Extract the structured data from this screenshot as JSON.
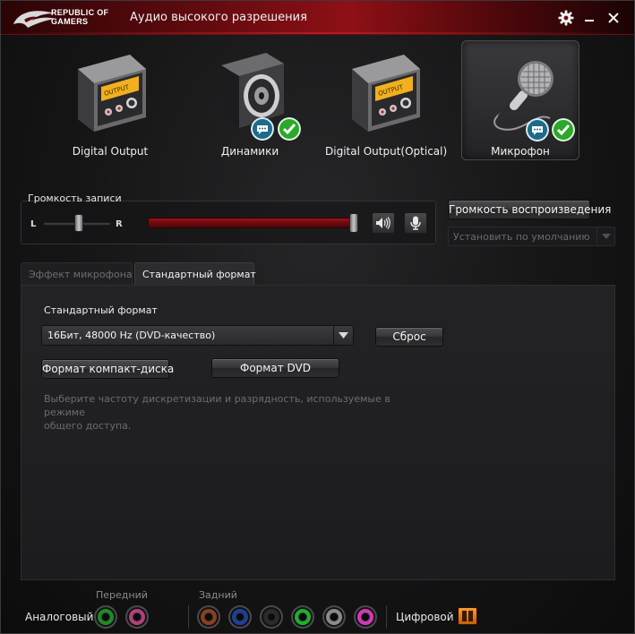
{
  "window": {
    "logo_text_line1": "REPUBLIC OF",
    "logo_text_line2": "GAMERS",
    "title": "Аудио высокого разрешения",
    "accent_color": "#8e1016"
  },
  "devices": [
    {
      "label": "Digital Output",
      "icon": "digital-output-device-icon",
      "active": false
    },
    {
      "label": "Динамики",
      "icon": "speaker-icon",
      "active": false,
      "badges": [
        "chat-bubble-icon",
        "check-icon"
      ]
    },
    {
      "label": "Digital Output(Optical)",
      "icon": "optical-output-device-icon",
      "active": false
    },
    {
      "label": "Микрофон",
      "icon": "microphone-icon",
      "active": true,
      "badges": [
        "chat-bubble-icon",
        "check-icon"
      ]
    }
  ],
  "record": {
    "label": "Громкость записи",
    "left": "L",
    "right": "R",
    "balance": 0.5,
    "volume": 1.0
  },
  "side": {
    "playback_volume_button": "Громкость воспроизведения",
    "set_default": "Установить по умолчанию"
  },
  "tabs": [
    {
      "label": "Эффект микрофона",
      "active": false
    },
    {
      "label": "Стандартный формат",
      "active": true
    }
  ],
  "format": {
    "label": "Стандартный формат",
    "selected": "16Бит, 48000 Hz (DVD-качество)",
    "reset_button": "Сброс",
    "cd_button": "Формат компакт-диска",
    "dvd_button": "Формат DVD",
    "hint_line1": "Выберите частоту дискретизации и разрядность, используемые в режиме",
    "hint_line2": "общего доступа."
  },
  "jacks": {
    "analog_label": "Аналоговый",
    "front_label": "Передний",
    "rear_label": "Задний",
    "digital_label": "Цифровой",
    "front": [
      {
        "color": "#1f8a26"
      },
      {
        "color": "#b0407c"
      }
    ],
    "rear": [
      {
        "color": "#8a3f1e"
      },
      {
        "color": "#1f3f9a"
      },
      {
        "color": "#2a2a2c"
      },
      {
        "color": "#1fae2c"
      },
      {
        "color": "#8a8a8c"
      },
      {
        "color": "#d03ab4"
      }
    ]
  }
}
